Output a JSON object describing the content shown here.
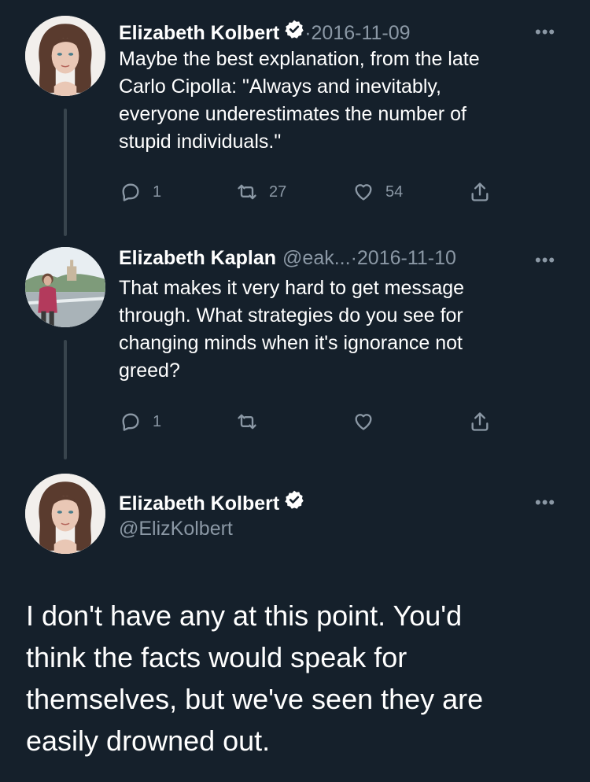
{
  "tweets": [
    {
      "name": "Elizabeth Kolbert",
      "sep": " · ",
      "date": "2016-11-09",
      "lines": [
        "Maybe the best explanation, from the late",
        "Carlo Cipolla: \"Always and inevitably,",
        "everyone underestimates the number of",
        "stupid individuals.\""
      ],
      "replies": "1",
      "retweets": "27",
      "likes": "54"
    },
    {
      "name": "Elizabeth Kaplan",
      "handle": "@eak...",
      "sep": " · ",
      "date": "2016-11-10",
      "lines": [
        "That makes it very hard to get message",
        "through. What strategies do you see for",
        "changing minds when it's ignorance not",
        "greed?"
      ],
      "replies": "1"
    }
  ],
  "main_tweet": {
    "name": "Elizabeth Kolbert",
    "handle": "@ElizKolbert",
    "lines": [
      "I don't have any at this point. You'd",
      "think the facts would speak for",
      "themselves, but we've seen they are",
      "easily drowned out."
    ]
  },
  "more_glyph": "•••",
  "colors": {
    "background": "#15202b",
    "secondary_text": "#8b98a5",
    "thread_line": "#38444d"
  }
}
